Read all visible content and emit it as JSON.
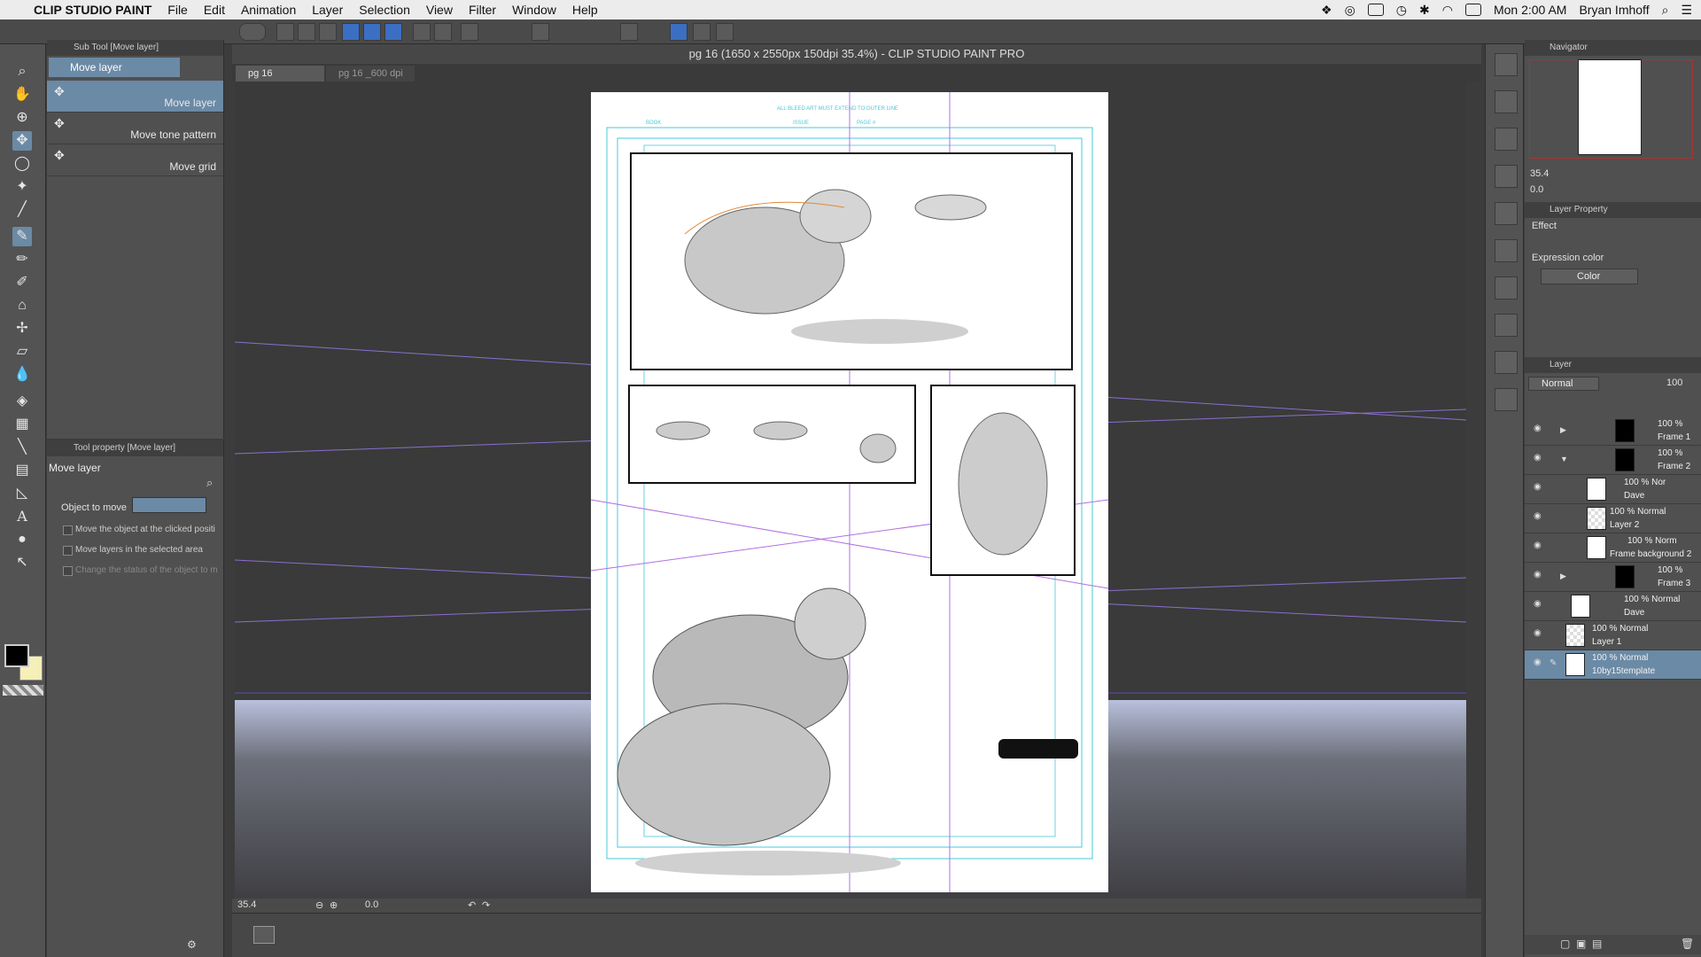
{
  "menubar": {
    "app_name": "CLIP STUDIO PAINT",
    "items": [
      "File",
      "Edit",
      "Animation",
      "Layer",
      "Selection",
      "View",
      "Filter",
      "Window",
      "Help"
    ],
    "clock": "Mon 2:00 AM",
    "user": "Bryan Imhoff"
  },
  "document": {
    "window_title": "pg 16 (1650 x 2550px 150dpi 35.4%)  - CLIP STUDIO PAINT PRO",
    "tabs": [
      {
        "label": "pg 16",
        "active": true
      },
      {
        "label": "pg 16 _600 dpi",
        "active": false
      }
    ],
    "zoom": "35.4",
    "rotation": "0.0"
  },
  "subtool": {
    "panel_title": "Sub Tool [Move layer]",
    "group_tab": "Move layer",
    "items": [
      "Move layer",
      "Move tone pattern",
      "Move grid"
    ]
  },
  "tool_property": {
    "panel_title": "Tool property [Move layer]",
    "tool_name": "Move layer",
    "object_to_move_label": "Object to move",
    "options": [
      {
        "label": "Move the object at the clicked positi",
        "checked": false,
        "enabled": true
      },
      {
        "label": "Move layers in the selected area",
        "checked": false,
        "enabled": true
      },
      {
        "label": "Change the status of the object to m",
        "checked": false,
        "enabled": false
      }
    ]
  },
  "colors": {
    "main": "#000000",
    "sub": "#f5efb8",
    "accent_selection": "#6b8aa6"
  },
  "navigator": {
    "title": "Navigator",
    "zoom": "35.4",
    "rotation": "0.0"
  },
  "layer_property": {
    "title": "Layer Property",
    "effect_label": "Effect",
    "expression_color_label": "Expression color",
    "expression_color_value": "Color"
  },
  "layer_panel": {
    "title": "Layer",
    "blend_mode": "Normal",
    "opacity": "100",
    "layers": [
      {
        "mode": "100 %",
        "name": "Frame 1",
        "type": "folder",
        "selected": false
      },
      {
        "mode": "100 %",
        "name": "Frame 2",
        "type": "folder",
        "selected": false
      },
      {
        "mode": "100 % Nor",
        "name": "Dave",
        "type": "3d",
        "selected": false
      },
      {
        "mode": "100 % Normal",
        "name": "Layer 2",
        "type": "raster",
        "selected": false
      },
      {
        "mode": "100 % Norm",
        "name": "Frame background 2",
        "type": "paper",
        "selected": false
      },
      {
        "mode": "100 %",
        "name": "Frame 3",
        "type": "folder",
        "selected": false
      },
      {
        "mode": "100 % Normal",
        "name": "Dave",
        "type": "3d",
        "selected": false
      },
      {
        "mode": "100 % Normal",
        "name": "Layer 1",
        "type": "raster",
        "selected": false
      },
      {
        "mode": "100 % Normal",
        "name": "10by15template",
        "type": "paper",
        "selected": true
      }
    ]
  },
  "page_guides": {
    "top_note": "ALL BLEED ART MUST EXTEND TO OUTER LINE",
    "book_label": "BOOK",
    "issue_label": "ISSUE",
    "page_label": "PAGE #"
  }
}
